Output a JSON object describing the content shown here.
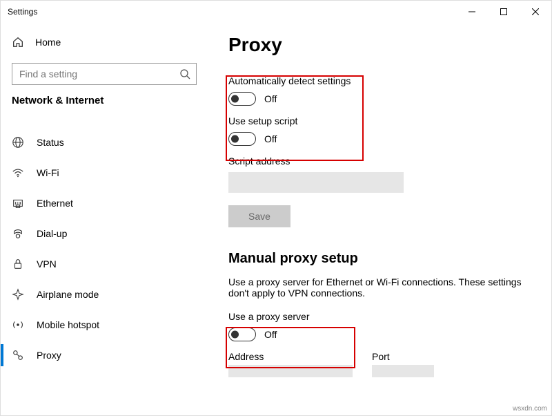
{
  "window": {
    "title": "Settings"
  },
  "sidebar": {
    "home_label": "Home",
    "search_placeholder": "Find a setting",
    "group_title": "Network & Internet",
    "items": [
      {
        "label": "Status"
      },
      {
        "label": "Wi-Fi"
      },
      {
        "label": "Ethernet"
      },
      {
        "label": "Dial-up"
      },
      {
        "label": "VPN"
      },
      {
        "label": "Airplane mode"
      },
      {
        "label": "Mobile hotspot"
      },
      {
        "label": "Proxy"
      }
    ]
  },
  "page": {
    "title": "Proxy",
    "auto_detect": {
      "label": "Automatically detect settings",
      "state": "Off"
    },
    "setup_script": {
      "label": "Use setup script",
      "state": "Off"
    },
    "script_address_label": "Script address",
    "save_label": "Save",
    "manual_section_title": "Manual proxy setup",
    "manual_desc": "Use a proxy server for Ethernet or Wi-Fi connections. These settings don't apply to VPN connections.",
    "use_proxy_server": {
      "label": "Use a proxy server",
      "state": "Off"
    },
    "address_label": "Address",
    "port_label": "Port"
  },
  "watermark": "wsxdn.com"
}
